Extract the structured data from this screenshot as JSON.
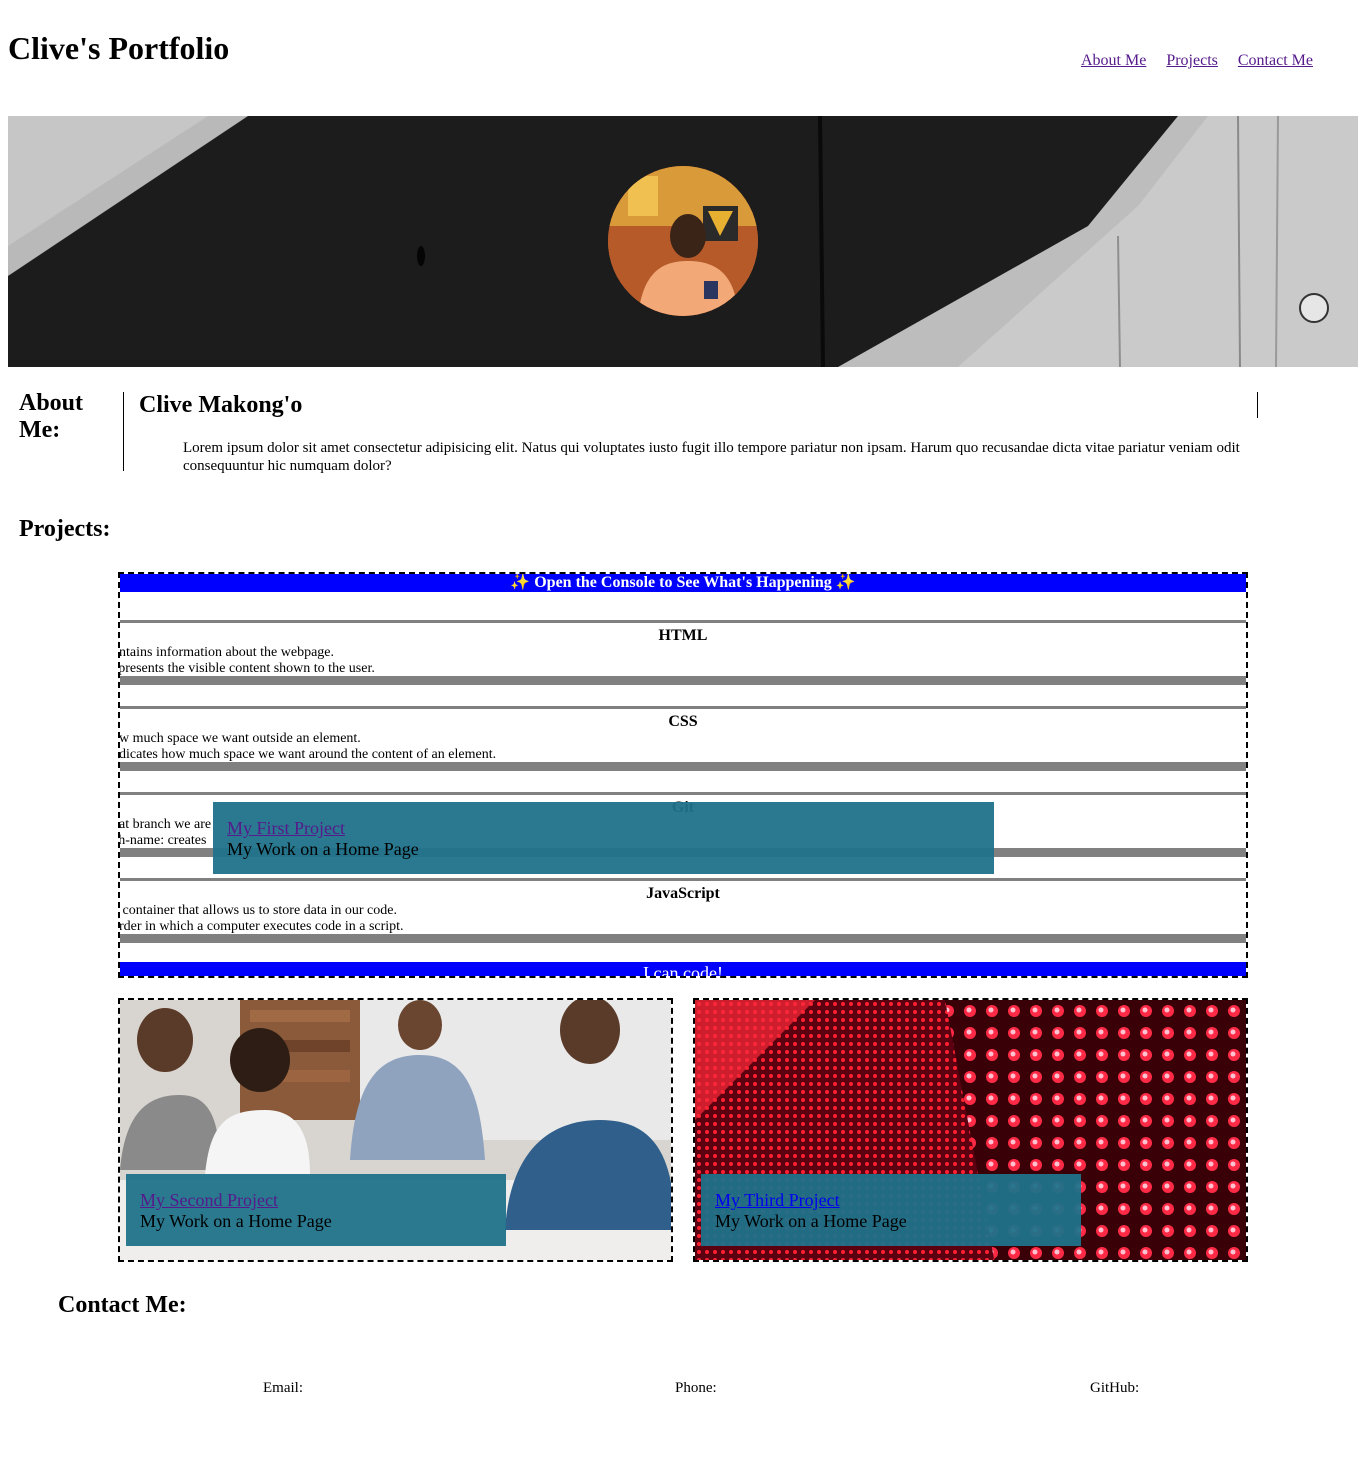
{
  "header": {
    "title": "Clive's Portfolio",
    "nav": [
      "About Me",
      "Projects",
      "Contact Me"
    ]
  },
  "about": {
    "heading": "About Me:",
    "name": "Clive Makong'o",
    "text": "Lorem ipsum dolor sit amet consectetur adipisicing elit. Natus qui voluptates iusto fugit illo tempore pariatur non ipsam. Harum quo recusandae dicta vitae pariatur veniam odit consequuntur hic numquam dolor?"
  },
  "projects": {
    "heading": "Projects:",
    "first": {
      "banner_top": "✨ Open the Console to See What's Happening ✨",
      "banner_bottom": "I can code!",
      "topics": [
        {
          "title": "HTML",
          "lines": [
            "ontains information about the webpage.",
            "epresents the visible content shown to the user."
          ]
        },
        {
          "title": "CSS",
          "lines": [
            "ow much space we want outside an element.",
            "ndicates how much space we want around the content of an element."
          ]
        },
        {
          "title": "Git",
          "lines": [
            "nat branch we are",
            "ch-name: creates"
          ]
        },
        {
          "title": "JavaScript",
          "lines": [
            "d container that allows us to store data in our code.",
            "order in which a computer executes code in a script."
          ]
        }
      ],
      "link": "My First Project",
      "subtitle": "My Work on a Home Page"
    },
    "second": {
      "link": "My Second Project",
      "subtitle": "My Work on a Home Page"
    },
    "third": {
      "link": "My Third Project",
      "subtitle": "My Work on a Home Page"
    }
  },
  "contact": {
    "heading": "Contact Me:",
    "email_label": "Email:",
    "phone_label": "Phone:",
    "github_label": "GitHub:"
  },
  "colors": {
    "banner_blue": "#0000ff",
    "overlay_teal": "#1f728a",
    "visited_link": "#551a8b"
  }
}
